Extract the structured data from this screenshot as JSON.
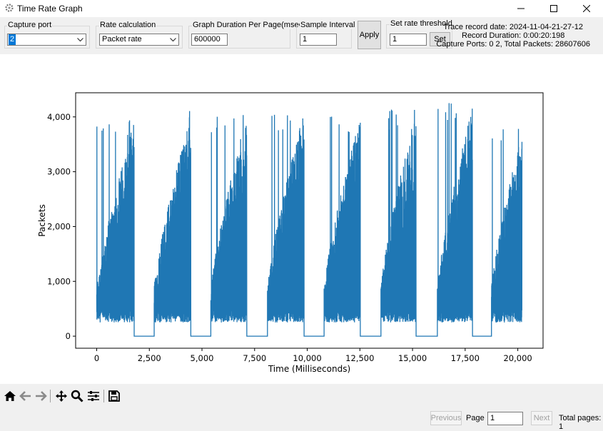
{
  "window": {
    "title": "Time Rate Graph",
    "app_icon": "gear-icon"
  },
  "controls": {
    "capture_port": {
      "label": "Capture port",
      "value": "2"
    },
    "rate_calculation": {
      "label": "Rate calculation",
      "value": "Packet rate"
    },
    "graph_duration": {
      "label": "Graph Duration Per Page(msec)",
      "value": "600000"
    },
    "sample_interval": {
      "label": "Sample Interval",
      "value": "1"
    },
    "apply_label": "Apply",
    "rate_threshold": {
      "label": "Set rate threshold",
      "value": "1",
      "button": "Set"
    }
  },
  "info": {
    "line1": "Trace record date: 2024-11-04-21-27-12",
    "line2": "Record Duration: 0:00:20:198",
    "line3": "Capture Ports: 0 2, Total Packets: 28607606"
  },
  "chart_data": {
    "type": "line",
    "xlabel": "Time (Milliseconds)",
    "ylabel": "Packets",
    "xlim": [
      -1000,
      21200
    ],
    "ylim": [
      -220,
      4440
    ],
    "xticks": [
      0,
      2500,
      5000,
      7500,
      10000,
      12500,
      15000,
      17500,
      20000
    ],
    "xtick_labels": [
      "0",
      "2,500",
      "5,000",
      "7,500",
      "10,000",
      "12,500",
      "15,000",
      "17,500",
      "20,000"
    ],
    "yticks": [
      0,
      1000,
      2000,
      3000,
      4000
    ],
    "ytick_labels": [
      "0",
      "1,000",
      "2,000",
      "3,000",
      "4,000"
    ],
    "color": "#1f77b4",
    "grid": false,
    "bursts": [
      {
        "start": 0,
        "end": 1780,
        "peak": 3950
      },
      {
        "start": 2730,
        "end": 4470,
        "peak": 4120
      },
      {
        "start": 5420,
        "end": 7130,
        "peak": 4080
      },
      {
        "start": 8110,
        "end": 9850,
        "peak": 4140
      },
      {
        "start": 10800,
        "end": 12520,
        "peak": 4060
      },
      {
        "start": 13500,
        "end": 15170,
        "peak": 4160
      },
      {
        "start": 16180,
        "end": 17850,
        "peak": 4270
      },
      {
        "start": 18750,
        "end": 20200,
        "peak": 3820
      }
    ],
    "gap_value": 0,
    "burst_floor": 250
  },
  "toolbar": {
    "icons": [
      "home-icon",
      "back-arrow-icon",
      "forward-arrow-icon",
      "pan-icon",
      "zoom-icon",
      "configure-subplots-icon",
      "save-icon"
    ]
  },
  "pager": {
    "previous": "Previous",
    "page_label": "Page",
    "page_value": "1",
    "next": "Next",
    "total": "Total pages: 1"
  }
}
